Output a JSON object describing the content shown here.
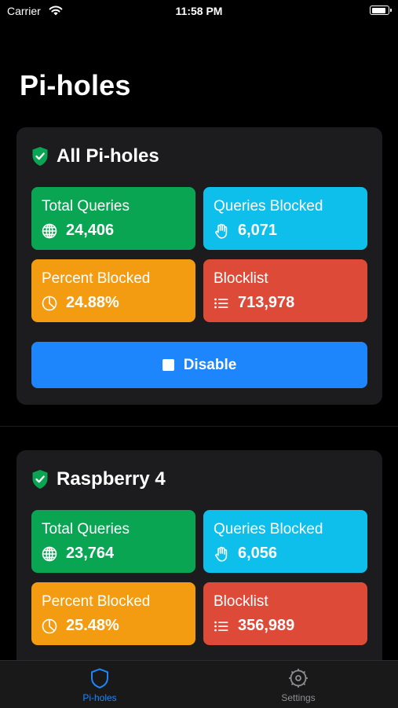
{
  "status_bar": {
    "carrier": "Carrier",
    "time": "11:58 PM"
  },
  "page": {
    "title": "Pi-holes"
  },
  "colors": {
    "total": "#0aa553",
    "blocked": "#0ebfeb",
    "percent": "#f39c12",
    "blocklist": "#dd4a38",
    "accent": "#1e86fc",
    "shield": "#0aa553"
  },
  "cards": [
    {
      "title": "All Pi-holes",
      "stats": [
        {
          "label": "Total Queries",
          "value": "24,406",
          "icon": "globe-icon"
        },
        {
          "label": "Queries Blocked",
          "value": "6,071",
          "icon": "hand-icon"
        },
        {
          "label": "Percent Blocked",
          "value": "24.88%",
          "icon": "pie-chart-icon"
        },
        {
          "label": "Blocklist",
          "value": "713,978",
          "icon": "list-icon"
        }
      ],
      "action_label": "Disable"
    },
    {
      "title": "Raspberry 4",
      "stats": [
        {
          "label": "Total Queries",
          "value": "23,764",
          "icon": "globe-icon"
        },
        {
          "label": "Queries Blocked",
          "value": "6,056",
          "icon": "hand-icon"
        },
        {
          "label": "Percent Blocked",
          "value": "25.48%",
          "icon": "pie-chart-icon"
        },
        {
          "label": "Blocklist",
          "value": "356,989",
          "icon": "list-icon"
        }
      ]
    }
  ],
  "tabs": [
    {
      "label": "Pi-holes",
      "icon": "shield-icon",
      "selected": true
    },
    {
      "label": "Settings",
      "icon": "gear-icon",
      "selected": false
    }
  ]
}
